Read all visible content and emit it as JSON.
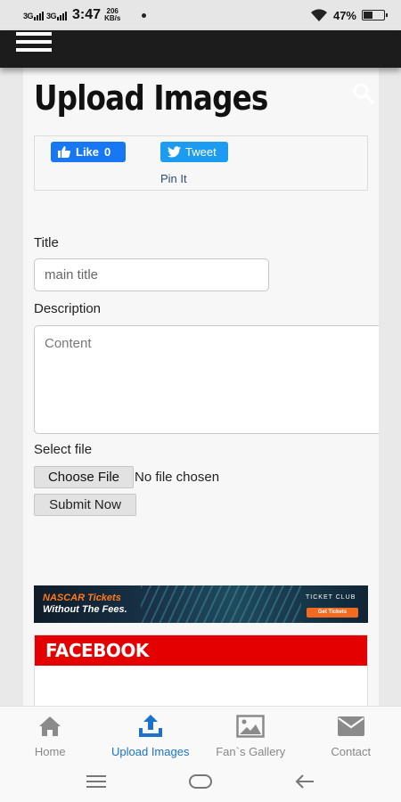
{
  "status": {
    "time": "3:47",
    "net1": "3G",
    "net2": "3G",
    "speed_value": "206",
    "speed_unit": "KB/s",
    "battery": "47%",
    "battery_level": 0.47
  },
  "header": {
    "menu_icon": "hamburger-menu-icon"
  },
  "page": {
    "title": "Upload Images"
  },
  "share": {
    "like_label": "Like",
    "like_count": "0",
    "tweet_label": "Tweet",
    "pin_label": "Pin It"
  },
  "form": {
    "title_label": "Title",
    "title_placeholder": "main title",
    "description_label": "Description",
    "description_placeholder": "Content",
    "file_label": "Select file",
    "choose_file_label": "Choose File",
    "no_file_text": "No file chosen",
    "submit_label": "Submit Now"
  },
  "ad": {
    "line1": "NASCAR Tickets",
    "line2": "Without The Fees.",
    "brand": "TICKET CLUB",
    "cta": "Get Tickets"
  },
  "facebook": {
    "heading": "FACEBOOK"
  },
  "bottom_nav": {
    "items": [
      {
        "label": "Home",
        "icon": "home-icon"
      },
      {
        "label": "Upload Images",
        "icon": "upload-icon"
      },
      {
        "label": "Fan`s Gallery",
        "icon": "image-gallery-icon"
      },
      {
        "label": "Contact",
        "icon": "envelope-icon"
      }
    ],
    "active_index": 1,
    "active_color": "#1a73c8",
    "inactive_color": "#888888"
  },
  "colors": {
    "header_bg": "#1c1c1c",
    "facebook_red": "#e40000",
    "fb_blue": "#1877f2",
    "twitter_blue": "#1d9bf0"
  }
}
